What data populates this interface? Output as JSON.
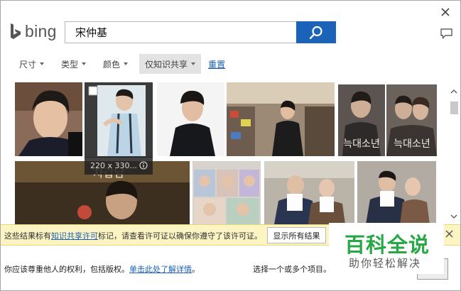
{
  "header": {
    "logo_text": "bing",
    "search_value": "宋仲基"
  },
  "filters": {
    "items": [
      "尺寸",
      "类型",
      "颜色",
      "仅知识共享"
    ],
    "reset": "重置"
  },
  "hover": {
    "size_text": "220 x 330..."
  },
  "notice": {
    "text_before": "这些结果标有",
    "link": "知识共享许可",
    "text_after": "标记，请查看许可证以确保你遵守了该许可证。",
    "show_all": "显示所有结果"
  },
  "footer": {
    "rights_text": "你应该尊重他人的权利，包括版权。",
    "rights_link": "单击此处了解详情",
    "rights_end": "。",
    "select_text": "选择一个或多个项目。"
  },
  "watermark": {
    "title": "百科全说",
    "subtitle": "助你轻松解决"
  },
  "colors": {
    "accent": "#1b63b8",
    "link": "#1a5fb4",
    "notice_bg": "#fdf4c4",
    "watermark_green": "#27a844"
  }
}
